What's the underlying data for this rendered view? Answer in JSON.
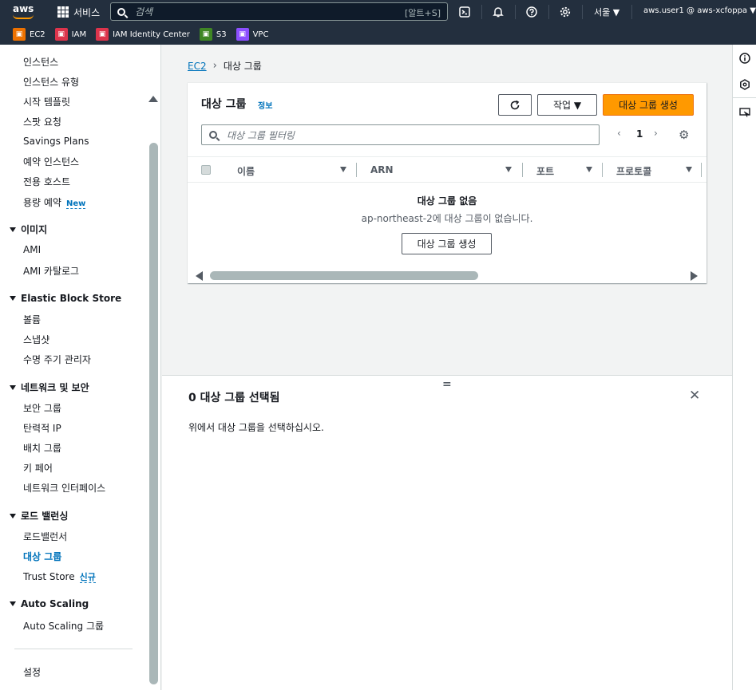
{
  "topnav": {
    "logo_text": "aws",
    "services_label": "서비스",
    "search_placeholder": "검색",
    "search_shortcut": "[알트+S]",
    "region": "서울 ▼",
    "account": "aws.user1 @ aws-xcfoppa ▼"
  },
  "favorites": [
    {
      "label": "EC2",
      "color": "#ed7100",
      "icon": "ec2-icon"
    },
    {
      "label": "IAM",
      "color": "#dd344c",
      "icon": "iam-icon"
    },
    {
      "label": "IAM Identity Center",
      "color": "#dd344c",
      "icon": "identity-center-icon"
    },
    {
      "label": "S3",
      "color": "#3f8624",
      "icon": "s3-icon"
    },
    {
      "label": "VPC",
      "color": "#8c4fff",
      "icon": "vpc-icon"
    }
  ],
  "sidebar": {
    "items": [
      {
        "label": "인스턴스"
      },
      {
        "label": "인스턴스 유형"
      },
      {
        "label": "시작 템플릿"
      },
      {
        "label": "스팟 요청"
      },
      {
        "label": "Savings Plans"
      },
      {
        "label": "예약 인스턴스"
      },
      {
        "label": "전용 호스트"
      },
      {
        "label": "용량 예약",
        "badge": "New"
      }
    ],
    "sections": [
      {
        "title": "이미지",
        "items": [
          "AMI",
          "AMI 카탈로그"
        ]
      },
      {
        "title": "Elastic Block Store",
        "items": [
          "볼륨",
          "스냅샷",
          "수명 주기 관리자"
        ]
      },
      {
        "title": "네트워크 및 보안",
        "items": [
          "보안 그룹",
          "탄력적 IP",
          "배치 그룹",
          "키 페어",
          "네트워크 인터페이스"
        ]
      },
      {
        "title": "로드 밸런싱",
        "items": [
          "로드밸런서",
          "대상 그룹",
          "Trust Store"
        ],
        "badge": "신규"
      },
      {
        "title": "Auto Scaling",
        "items": [
          "Auto Scaling 그룹"
        ]
      }
    ],
    "footer": "설정"
  },
  "breadcrumb": {
    "root": "EC2",
    "current": "대상 그룹"
  },
  "panel": {
    "title": "대상 그룹",
    "info": "정보",
    "actions_label": "작업 ▼",
    "create_label": "대상 그룹 생성",
    "filter_placeholder": "대상 그룹 필터링",
    "page": "1",
    "columns": [
      "이름",
      "ARN",
      "포트",
      "프로토콜"
    ],
    "empty_title": "대상 그룹 없음",
    "empty_desc": "ap-northeast-2에 대상 그룹이 없습니다.",
    "empty_button": "대상 그룹 생성"
  },
  "split": {
    "title": "0 대상 그룹 선택됨",
    "desc": "위에서 대상 그룹을 선택하십시오."
  }
}
